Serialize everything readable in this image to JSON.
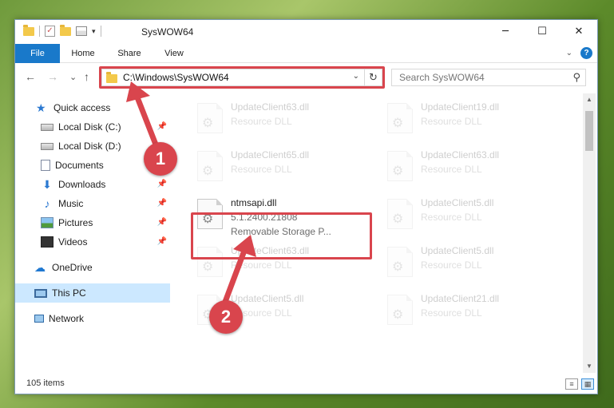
{
  "window": {
    "title": "SysWOW64",
    "controls": {
      "minimize": "─",
      "maximize": "☐",
      "close": "✕"
    }
  },
  "ribbon": {
    "tabs": [
      "File",
      "Home",
      "Share",
      "View"
    ]
  },
  "navigation": {
    "back": "←",
    "forward": "→",
    "recent": "⌄",
    "up": "↑",
    "address": "C:\\Windows\\SysWOW64",
    "search_placeholder": "Search SysWOW64"
  },
  "sidebar": {
    "items": [
      {
        "label": "Quick access",
        "icon": "star-icon",
        "pinned": false
      },
      {
        "label": "Local Disk (C:)",
        "icon": "disk-icon",
        "pinned": true
      },
      {
        "label": "Local Disk (D:)",
        "icon": "disk-icon",
        "pinned": false
      },
      {
        "label": "Documents",
        "icon": "documents-icon",
        "pinned": true
      },
      {
        "label": "Downloads",
        "icon": "download-icon",
        "pinned": true
      },
      {
        "label": "Music",
        "icon": "music-icon",
        "pinned": true
      },
      {
        "label": "Pictures",
        "icon": "pictures-icon",
        "pinned": true
      },
      {
        "label": "Videos",
        "icon": "videos-icon",
        "pinned": true
      },
      {
        "label": "OneDrive",
        "icon": "onedrive-icon",
        "pinned": false
      },
      {
        "label": "This PC",
        "icon": "pc-icon",
        "pinned": false,
        "selected": true
      },
      {
        "label": "Network",
        "icon": "network-icon",
        "pinned": false
      }
    ]
  },
  "files": [
    {
      "name": "UpdateClient63.dll",
      "line1": "Resource DLL",
      "line2": "",
      "faded": true
    },
    {
      "name": "UpdateClient19.dll",
      "line1": "Resource DLL",
      "line2": "",
      "faded": true
    },
    {
      "name": "UpdateClient65.dll",
      "line1": "Resource DLL",
      "line2": "",
      "faded": true
    },
    {
      "name": "UpdateClient63.dll",
      "line1": "Resource DLL",
      "line2": "",
      "faded": true
    },
    {
      "name": "ntmsapi.dll",
      "line1": "5.1.2400.21808",
      "line2": "Removable Storage P...",
      "faded": false
    },
    {
      "name": "UpdateClient5.dll",
      "line1": "Resource DLL",
      "line2": "",
      "faded": true
    },
    {
      "name": "UpdateClient63.dll",
      "line1": "Resource DLL",
      "line2": "",
      "faded": true
    },
    {
      "name": "UpdateClient5.dll",
      "line1": "Resource DLL",
      "line2": "",
      "faded": true
    },
    {
      "name": "UpdateClient5.dll",
      "line1": "Resource DLL",
      "line2": "",
      "faded": true
    },
    {
      "name": "UpdateClient21.dll",
      "line1": "Resource DLL",
      "line2": "",
      "faded": true
    }
  ],
  "status": {
    "item_count": "105 items"
  },
  "callouts": [
    "1",
    "2"
  ],
  "colors": {
    "accent": "#1979ca",
    "highlight": "#d9454d",
    "selected": "#cce8ff"
  }
}
